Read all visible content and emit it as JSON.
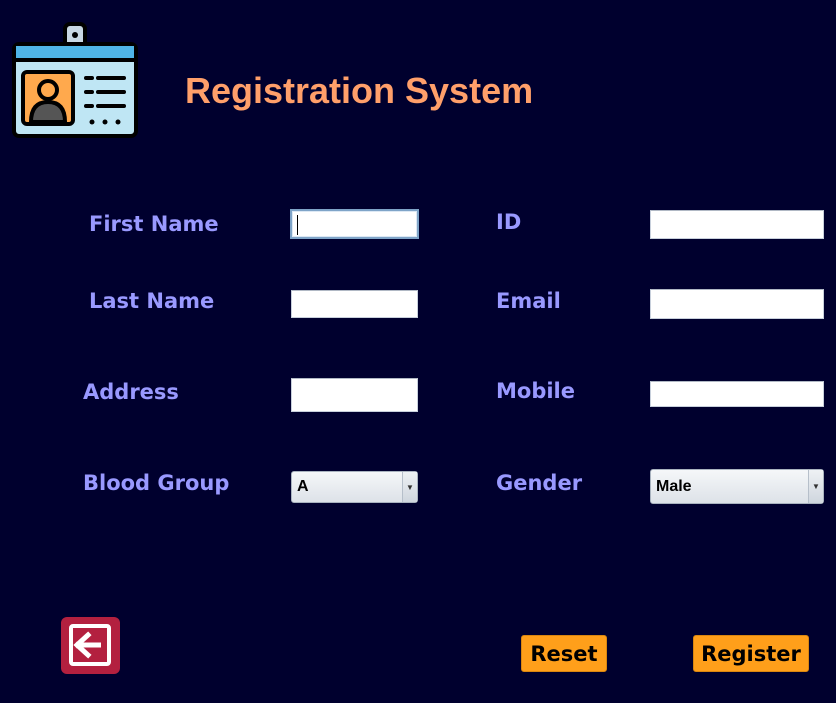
{
  "header": {
    "title": "Registration System",
    "logo_icon": "id-card-icon"
  },
  "form": {
    "first_name": {
      "label": "First Name",
      "value": ""
    },
    "last_name": {
      "label": "Last Name",
      "value": ""
    },
    "address": {
      "label": "Address",
      "value": ""
    },
    "blood_group": {
      "label": "Blood Group",
      "selected": "A"
    },
    "id": {
      "label": "ID",
      "value": ""
    },
    "email": {
      "label": "Email",
      "value": ""
    },
    "mobile": {
      "label": "Mobile",
      "value": ""
    },
    "gender": {
      "label": "Gender",
      "selected": "Male"
    }
  },
  "actions": {
    "back_icon": "exit-arrow-icon",
    "reset_label": "Reset",
    "register_label": "Register"
  },
  "colors": {
    "background": "#00002e",
    "title": "#ff9f6a",
    "label": "#9999ff",
    "button": "#ff9f1a",
    "back_button": "#b3203f"
  }
}
